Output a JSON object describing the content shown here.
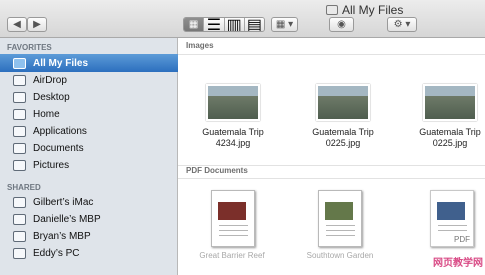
{
  "window": {
    "title": "All My Files"
  },
  "sidebar": {
    "favorites_label": "FAVORITES",
    "favorites": [
      {
        "label": "All My Files",
        "icon": "files-icon"
      },
      {
        "label": "AirDrop",
        "icon": "airdrop-icon"
      },
      {
        "label": "Desktop",
        "icon": "desktop-icon"
      },
      {
        "label": "Home",
        "icon": "home-icon"
      },
      {
        "label": "Applications",
        "icon": "applications-icon"
      },
      {
        "label": "Documents",
        "icon": "documents-icon"
      },
      {
        "label": "Pictures",
        "icon": "pictures-icon"
      }
    ],
    "shared_label": "SHARED",
    "shared": [
      {
        "label": "Gilbert’s iMac",
        "icon": "imac-icon"
      },
      {
        "label": "Danielle’s MBP",
        "icon": "laptop-icon"
      },
      {
        "label": "Bryan’s MBP",
        "icon": "laptop-icon"
      },
      {
        "label": "Eddy’s PC",
        "icon": "pc-icon"
      }
    ]
  },
  "content": {
    "images_label": "Images",
    "images": [
      {
        "line1": "Guatemala Trip",
        "line2": "4234.jpg"
      },
      {
        "line1": "Guatemala Trip",
        "line2": "0225.jpg"
      },
      {
        "line1": "Guatemala Trip",
        "line2": "0225.jpg"
      }
    ],
    "pdf_label": "PDF Documents",
    "pdfs": [
      {
        "label": "Great Barrier Reef"
      },
      {
        "label": "Southtown Garden"
      },
      {
        "label": "PDF"
      }
    ]
  },
  "watermark": "网页教学网"
}
